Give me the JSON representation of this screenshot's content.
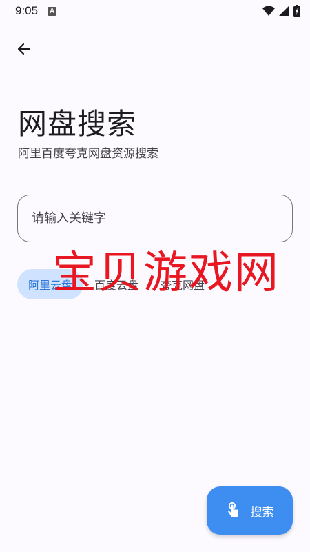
{
  "status_bar": {
    "time": "9:05",
    "a_icon": "A",
    "icons": [
      "wifi-icon",
      "signal-icon",
      "battery-icon"
    ]
  },
  "nav": {
    "back_icon": "arrow-left-icon"
  },
  "header": {
    "title": "网盘搜索",
    "subtitle": "阿里百度夸克网盘资源搜索"
  },
  "search": {
    "placeholder": "请输入关键字",
    "value": ""
  },
  "tabs": [
    {
      "label": "阿里云盘",
      "active": true
    },
    {
      "label": "百度云盘",
      "active": false
    },
    {
      "label": "夸克网盘",
      "active": false
    }
  ],
  "watermark": {
    "text": "宝贝游戏网",
    "color": "#e8101a"
  },
  "fab": {
    "label": "搜索",
    "icon": "tap-hand-icon"
  },
  "colors": {
    "background": "#fcf9ff",
    "accent": "#3e8ef1",
    "tab_active_bg": "#cfe2ff",
    "tab_active_text": "#2f78d8"
  }
}
